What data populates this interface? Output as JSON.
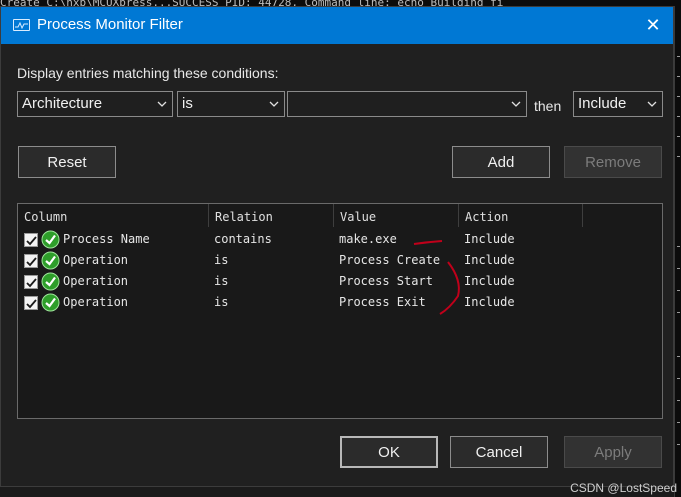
{
  "background": {
    "console_text": "Create          C:\\nxp\\MCUXpress...SUCCESS              PID: 44728, Command line: echo  Building fi"
  },
  "window": {
    "title": "Process Monitor Filter",
    "close_glyph": "✕",
    "accent_color": "#0078d4"
  },
  "condition": {
    "prompt": "Display entries matching these conditions:",
    "column_value": "Architecture",
    "relation_value": "is",
    "value_text": "",
    "then_label": "then",
    "action_value": "Include"
  },
  "buttons": {
    "reset": "Reset",
    "add": "Add",
    "remove": "Remove",
    "ok": "OK",
    "cancel": "Cancel",
    "apply": "Apply"
  },
  "table": {
    "headers": [
      "Column",
      "Relation",
      "Value",
      "Action"
    ],
    "rows": [
      {
        "checked": true,
        "column": "Process Name",
        "relation": "contains",
        "value": "make.exe",
        "action": "Include"
      },
      {
        "checked": true,
        "column": "Operation",
        "relation": "is",
        "value": "Process Create",
        "action": "Include"
      },
      {
        "checked": true,
        "column": "Operation",
        "relation": "is",
        "value": "Process Start",
        "action": "Include"
      },
      {
        "checked": true,
        "column": "Operation",
        "relation": "is",
        "value": "Process Exit",
        "action": "Include"
      }
    ]
  },
  "watermark": "CSDN @LostSpeed",
  "icons": {
    "title": "monitor-app-icon",
    "row": "green-check-icon",
    "dropdown": "chevron-down-icon"
  },
  "annotation_color": "#c0001a"
}
